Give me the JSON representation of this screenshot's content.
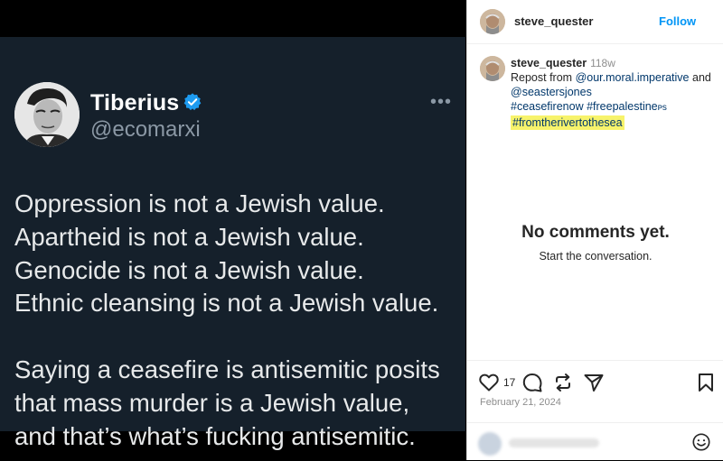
{
  "tweet": {
    "name": "Tiberius",
    "handle": "@ecomarxi",
    "more": "•••",
    "paragraph1": [
      "Oppression is not a Jewish value.",
      "Apartheid is not a Jewish value.",
      "Genocide is not a Jewish value.",
      "Ethnic cleansing is not a Jewish value."
    ],
    "paragraph2": [
      "Saying a ceasefire is antisemitic posits",
      "that mass murder is a Jewish value,",
      "and that’s what’s fucking antisemitic."
    ]
  },
  "post": {
    "username": "steve_quester",
    "follow_label": "Follow",
    "caption": {
      "username": "steve_quester",
      "age": "118w",
      "repost_prefix": "Repost from",
      "mention1": "@our.moral.imperative",
      "and": "and",
      "mention2": "@seastersjones",
      "hashtag1": "#ceasefirenow",
      "hashtag2": "#freepalestine",
      "hashtag2_suffix": "ᴘs",
      "hashtag3": "#fromtherivertothesea"
    },
    "empty_title": "No comments yet.",
    "empty_sub": "Start the conversation.",
    "like_count": "17",
    "date": "February 21, 2024"
  },
  "colors": {
    "tweet_bg": "#15202b",
    "verified_blue": "#1d9bf0",
    "follow_blue": "#0095f6",
    "highlight": "#f7f36b"
  },
  "icons": [
    "verified-badge-icon",
    "more-icon",
    "heart-icon",
    "comment-icon",
    "repost-icon",
    "share-icon",
    "bookmark-icon",
    "emoji-icon"
  ]
}
